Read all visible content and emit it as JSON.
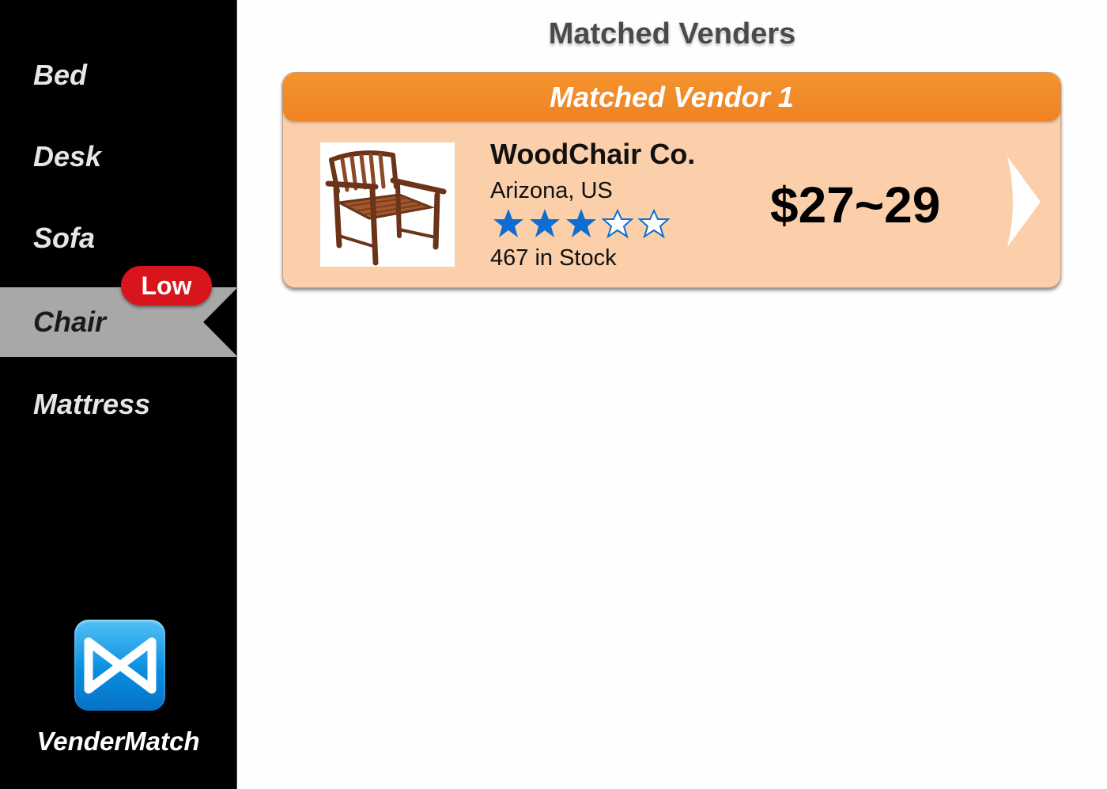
{
  "sidebar": {
    "items": [
      {
        "label": "Bed"
      },
      {
        "label": "Desk"
      },
      {
        "label": "Sofa"
      },
      {
        "label": "Chair",
        "badge": "Low"
      },
      {
        "label": "Mattress"
      }
    ],
    "active": "Chair",
    "app_name": "VenderMatch",
    "logo_icon": "vendermatch-logo-icon"
  },
  "main": {
    "title": "Matched Venders",
    "vendors": [
      {
        "header": "Matched Vendor 1",
        "name": "WoodChair Co.",
        "location": "Arizona, US",
        "rating": 3,
        "rating_max": 5,
        "stock": "467 in Stock",
        "price": "$27~29",
        "image_icon": "wooden-chair-image"
      }
    ]
  },
  "colors": {
    "accent_orange": "#f08224",
    "card_bg": "#fbcfa9",
    "badge_red": "#d8141c",
    "star_blue": "#0d6ed0"
  }
}
